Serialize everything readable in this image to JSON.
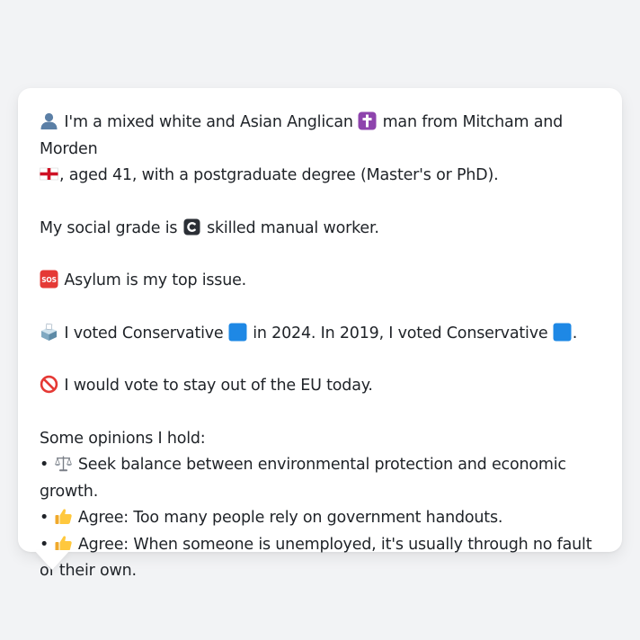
{
  "persona": {
    "intro": {
      "icon": "person-silhouette-icon",
      "t1": "I'm a mixed white and Asian Anglican",
      "religion_icon": "latin-cross-icon",
      "t2": "man from Mitcham and Morden",
      "flag_icon": "england-flag-icon",
      "t3": ", aged 41, with a postgraduate degree (Master's or PhD)."
    },
    "social": {
      "t1": "My social grade is",
      "grade_icon": "letter-c-icon",
      "t2": "skilled manual worker."
    },
    "issue": {
      "icon": "sos-icon",
      "text": "Asylum is my top issue."
    },
    "vote": {
      "icon": "ballot-box-icon",
      "t1": "I voted Conservative",
      "party_color": "#1e88e5",
      "t2": "in 2024. In 2019, I voted Conservative",
      "t3": "."
    },
    "eu": {
      "icon": "no-entry-icon",
      "text": "I would vote to stay out of the EU today."
    },
    "opinions": {
      "heading": "Some opinions I hold:",
      "items": [
        {
          "bullet": "•",
          "icon": "balance-scale-icon",
          "text": "Seek balance between environmental protection and economic growth."
        },
        {
          "bullet": "•",
          "icon": "thumbs-up-icon",
          "text": "Agree: Too many people rely on government handouts."
        },
        {
          "bullet": "•",
          "icon": "thumbs-up-icon",
          "text": "Agree: When someone is unemployed, it's usually through no fault of their own."
        }
      ]
    }
  },
  "colors": {
    "background": "#f2f3f5",
    "bubble": "#ffffff",
    "text": "#1f2328"
  }
}
